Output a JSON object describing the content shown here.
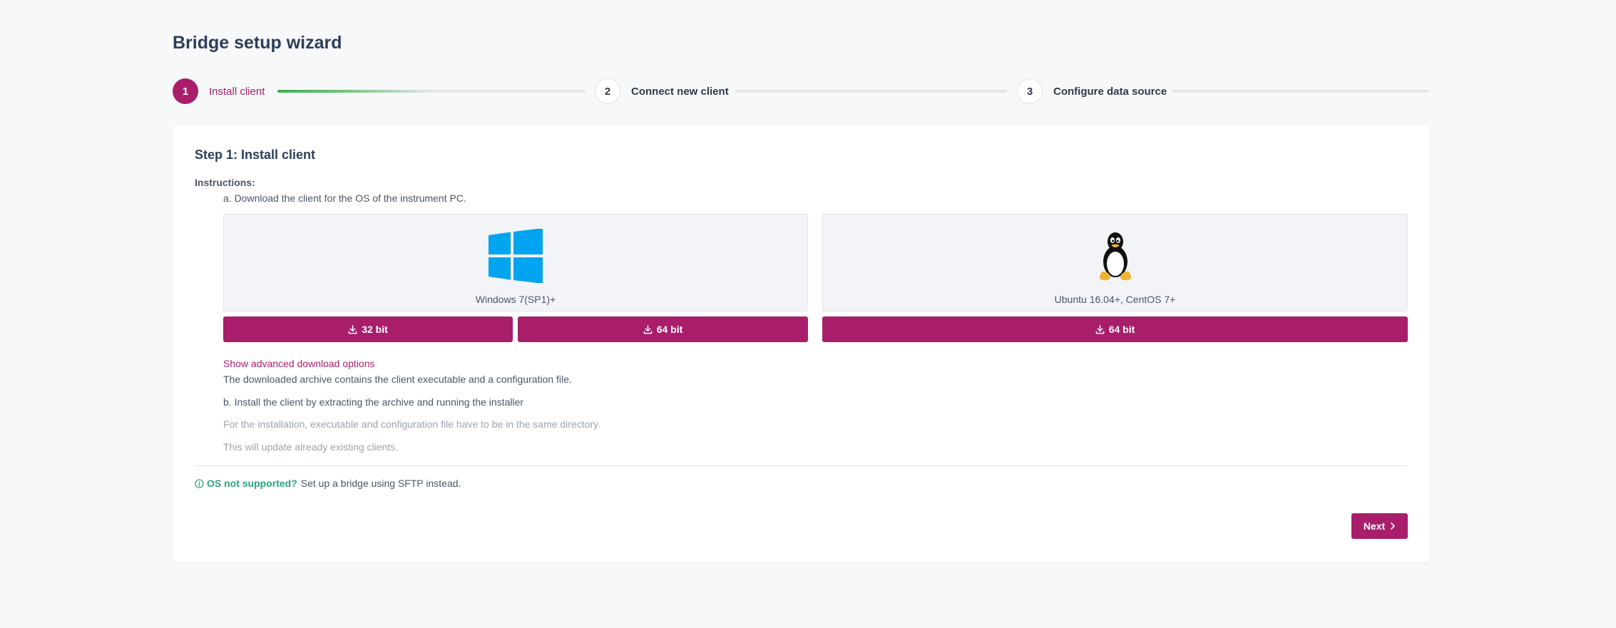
{
  "page": {
    "title": "Bridge setup wizard"
  },
  "stepper": {
    "steps": [
      {
        "number": "1",
        "label": "Install client",
        "active": true
      },
      {
        "number": "2",
        "label": "Connect new client",
        "active": false
      },
      {
        "number": "3",
        "label": "Configure data source",
        "active": false
      }
    ],
    "progress_step1": 0.5
  },
  "card": {
    "title": "Step 1: Install client",
    "instructions_label": "Instructions:",
    "step_a": "a. Download the client for the OS of the instrument PC.",
    "windows": {
      "caption": "Windows 7(SP1)+",
      "icon": "windows-logo-icon",
      "buttons": [
        "32 bit",
        "64 bit"
      ]
    },
    "linux": {
      "caption": "Ubuntu 16.04+, CentOS 7+",
      "icon": "linux-tux-icon",
      "buttons": [
        "64 bit"
      ]
    },
    "advanced_link": "Show advanced download options",
    "archive_note": "The downloaded archive contains the client executable and a configuration file.",
    "step_b": "b. Install the client by extracting the archive and running the installer",
    "note_1": "For the installation, executable and configuration file have to be in the same directory.",
    "note_2": "This will update already existing clients.",
    "os_support": {
      "strong": "OS not supported?",
      "rest": "Set up a bridge using SFTP instead."
    },
    "next_label": "Next"
  },
  "colors": {
    "accent": "#a81e6a",
    "success": "#3fae49",
    "info": "#2aa37a",
    "windows": "#00a4ef"
  }
}
